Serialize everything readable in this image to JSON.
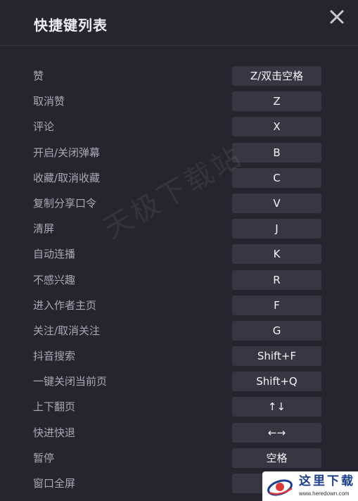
{
  "dialog": {
    "title": "快捷键列表",
    "close_icon": "close-icon"
  },
  "shortcuts": [
    {
      "label": "赞",
      "key": "Z/双击空格"
    },
    {
      "label": "取消赞",
      "key": "Z"
    },
    {
      "label": "评论",
      "key": "X"
    },
    {
      "label": "开启/关闭弹幕",
      "key": "B"
    },
    {
      "label": "收藏/取消收藏",
      "key": "C"
    },
    {
      "label": "复制分享口令",
      "key": "V"
    },
    {
      "label": "清屏",
      "key": "J"
    },
    {
      "label": "自动连播",
      "key": "K"
    },
    {
      "label": "不感兴趣",
      "key": "R"
    },
    {
      "label": "进入作者主页",
      "key": "F"
    },
    {
      "label": "关注/取消关注",
      "key": "G"
    },
    {
      "label": "抖音搜索",
      "key": "Shift+F"
    },
    {
      "label": "一键关闭当前页",
      "key": "Shift+Q"
    },
    {
      "label": "上下翻页",
      "key": "↑↓"
    },
    {
      "label": "快进快退",
      "key": "←→"
    },
    {
      "label": "暂停",
      "key": "空格"
    },
    {
      "label": "窗口全屏",
      "key": ""
    }
  ],
  "watermark": {
    "text": "天极下载站"
  },
  "badge": {
    "text": "这里下载",
    "url": "www.heredown.com"
  },
  "colors": {
    "background": "#25252f",
    "key_box": "#373743",
    "label_text": "#a9a8b4",
    "key_text": "#f4f3f7",
    "title_text": "#ecebf0"
  }
}
